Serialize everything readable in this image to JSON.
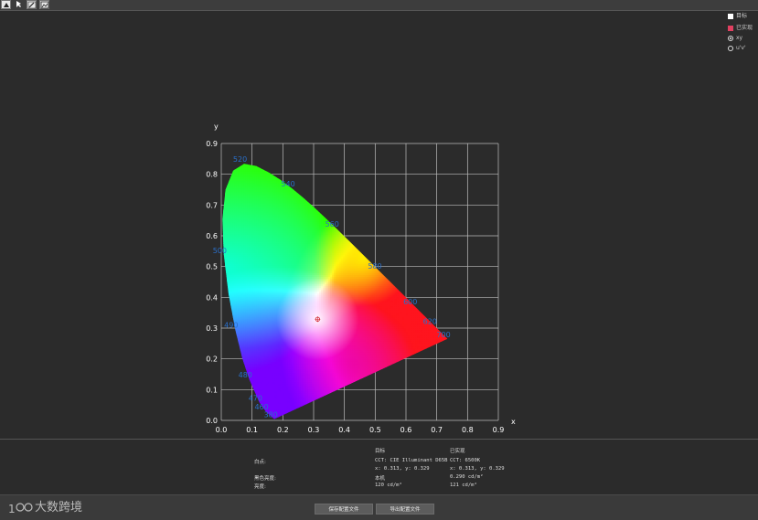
{
  "toolbar": {
    "icons": [
      "pointer-icon",
      "cursor-icon",
      "edit-icon",
      "image-icon"
    ]
  },
  "legend": {
    "target_label": "目标",
    "achieved_label": "已实现",
    "xy_label": "xy",
    "uv_label": "u'v'",
    "target_color": "#ffffff",
    "achieved_color": "#e04060"
  },
  "chart_data": {
    "type": "scatter",
    "title": "",
    "xlabel": "x",
    "ylabel": "y",
    "xlim": [
      0,
      0.9
    ],
    "ylim": [
      0,
      0.9
    ],
    "xticks": [
      "0.0",
      "0.1",
      "0.2",
      "0.3",
      "0.4",
      "0.5",
      "0.6",
      "0.7",
      "0.8",
      "0.9"
    ],
    "yticks": [
      "0.0",
      "0.1",
      "0.2",
      "0.3",
      "0.4",
      "0.5",
      "0.6",
      "0.7",
      "0.8",
      "0.9"
    ],
    "grid": true,
    "wavelength_labels": [
      {
        "text": "520",
        "x": 0.074,
        "y": 0.834
      },
      {
        "text": "540",
        "x": 0.23,
        "y": 0.754
      },
      {
        "text": "560",
        "x": 0.373,
        "y": 0.624
      },
      {
        "text": "580",
        "x": 0.512,
        "y": 0.487
      },
      {
        "text": "600",
        "x": 0.627,
        "y": 0.372
      },
      {
        "text": "620",
        "x": 0.691,
        "y": 0.308
      },
      {
        "text": "700",
        "x": 0.735,
        "y": 0.265
      },
      {
        "text": "500",
        "x": 0.008,
        "y": 0.538
      },
      {
        "text": "490",
        "x": 0.045,
        "y": 0.295
      },
      {
        "text": "480",
        "x": 0.091,
        "y": 0.133
      },
      {
        "text": "470",
        "x": 0.124,
        "y": 0.058
      },
      {
        "text": "460",
        "x": 0.144,
        "y": 0.03
      },
      {
        "text": "380",
        "x": 0.174,
        "y": 0.005
      }
    ],
    "points": [
      {
        "name": "white-point",
        "x": 0.313,
        "y": 0.329
      }
    ]
  },
  "info": {
    "col_target": "目标",
    "col_achieved": "已实现",
    "row_whitepoint": "白点:",
    "target_cct": "CCT: CIE Illuminant D65B",
    "target_xy": "x: 0.313, y: 0.329",
    "achieved_cct": "CCT: 6500K",
    "achieved_xy": "x: 0.313, y: 0.329",
    "row_black": "黑色亮度:",
    "target_black": "本机",
    "achieved_black": "0.290 cd/m²",
    "row_luminance": "亮度:",
    "target_lum": "120 cd/m²",
    "achieved_lum": "121 cd/m²"
  },
  "buttons": {
    "save_label": "保存配置文件",
    "export_label": "导出配置文件"
  },
  "logo": {
    "text": "大数跨境"
  }
}
